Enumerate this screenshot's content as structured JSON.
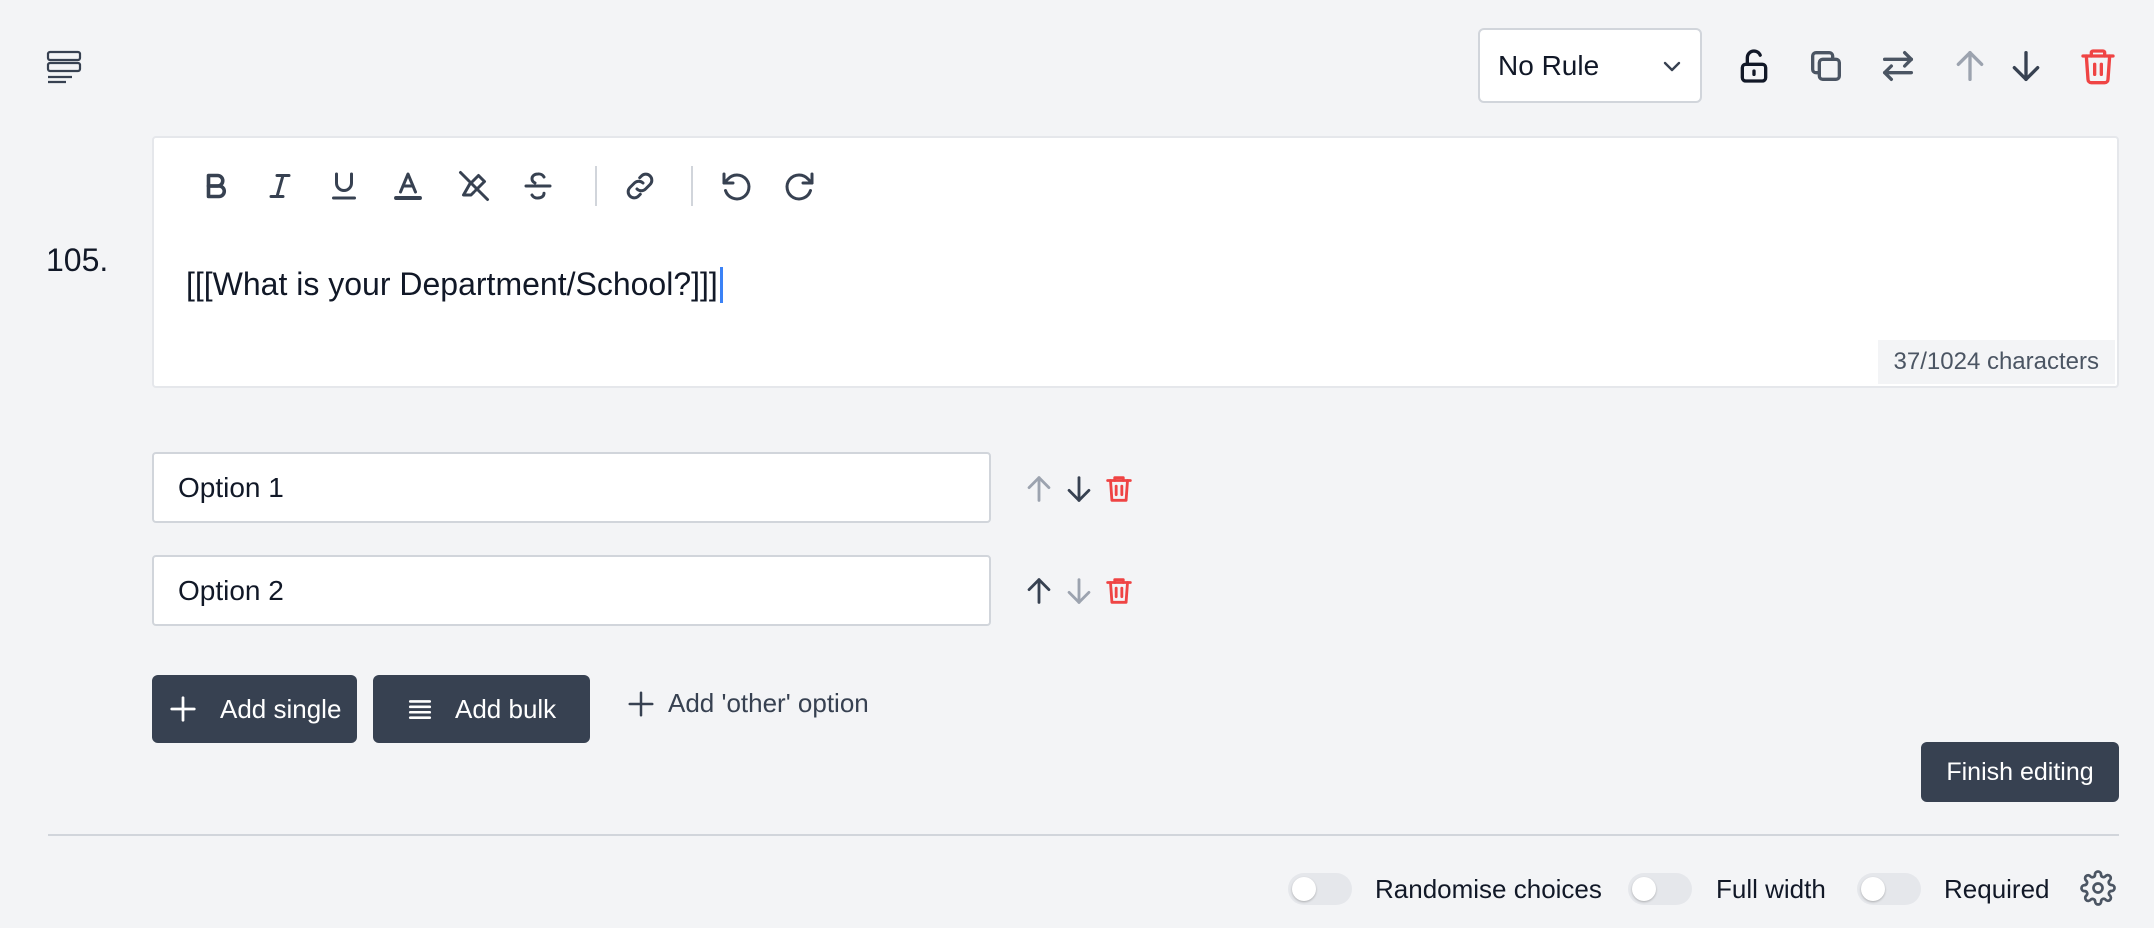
{
  "header": {
    "rule_select": {
      "value": "No Rule"
    }
  },
  "question": {
    "number": "105.",
    "text": "[[[What is your Department/School?]]]",
    "char_count": "37/1024 characters"
  },
  "options": [
    {
      "value": "Option 1"
    },
    {
      "value": "Option 2"
    }
  ],
  "actions": {
    "add_single": "Add single",
    "add_bulk": "Add bulk",
    "add_other": "Add 'other' option",
    "finish_editing": "Finish editing"
  },
  "footer": {
    "randomise": "Randomise choices",
    "full_width": "Full width",
    "required": "Required"
  },
  "colors": {
    "dark_button": "#374151",
    "danger": "#ef4444",
    "disabled": "#9ca3af",
    "caret": "#3b82f6"
  }
}
